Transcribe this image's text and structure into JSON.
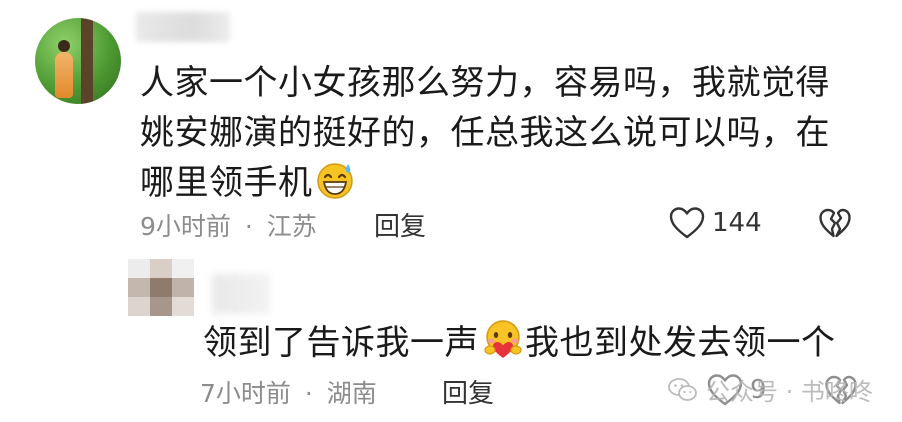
{
  "comments": [
    {
      "text_lines": [
        "人家一个小女孩那么努力，容易吗，我就觉得",
        "姚安娜演的挺好的，任总我这么说可以吗，在",
        "哪里领手机"
      ],
      "emoji": "grinning-sweat-emoji",
      "time": "9小时前",
      "separator": "·",
      "location": "江苏",
      "reply_label": "回复",
      "like_count": "144",
      "like_icon": "heart-outline-icon",
      "dislike_icon": "broken-heart-icon"
    },
    {
      "text": "领到了告诉我一声",
      "emoji": "face-holding-heart-emoji",
      "text_after_emoji": "我也到处发去领一个",
      "time": "7小时前",
      "separator": "·",
      "location": "湖南",
      "reply_label": "回复",
      "like_count": "9",
      "like_icon": "heart-outline-icon",
      "dislike_icon": "broken-heart-icon"
    }
  ],
  "watermark": {
    "icon": "wechat-icon",
    "text": "公众号 · 书咚咚"
  },
  "colors": {
    "text": "#1a1a1a",
    "meta": "#8c8c8c",
    "action": "#333333",
    "watermark": "#b5b5b5",
    "emoji_yellow": "#f7c325",
    "heart_red": "#e8323c"
  }
}
